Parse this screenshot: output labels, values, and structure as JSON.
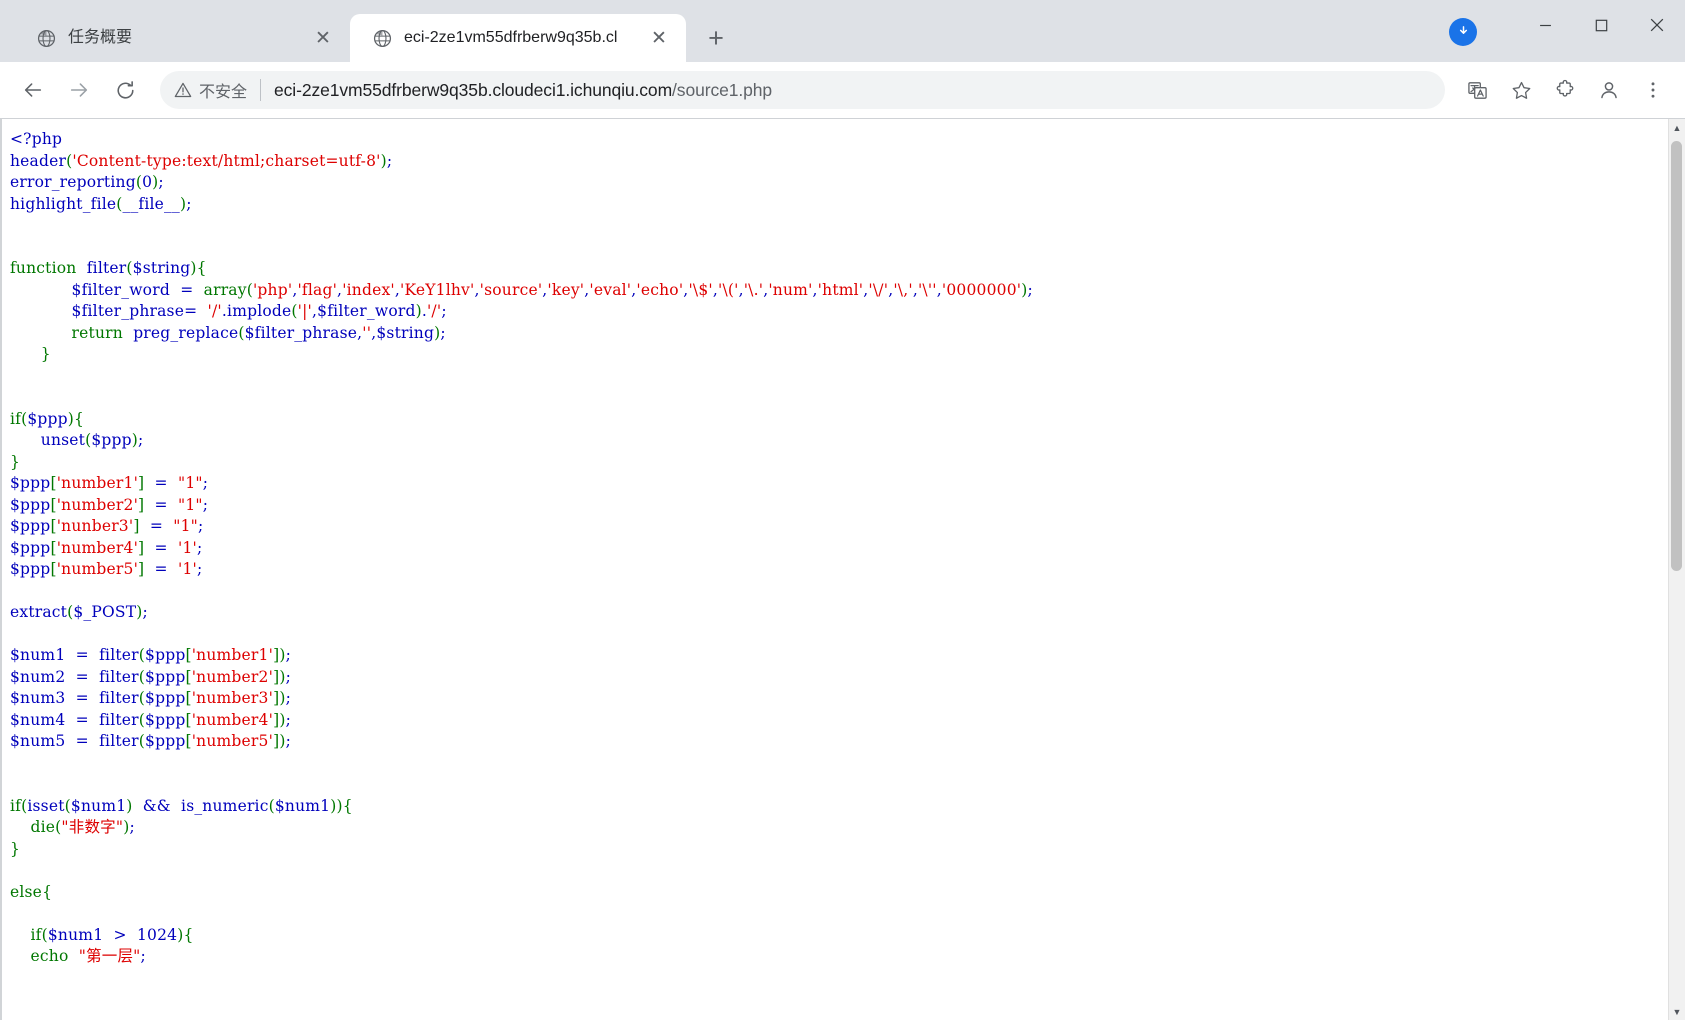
{
  "window": {
    "minimize_label": "Minimize",
    "maximize_label": "Maximize",
    "close_label": "Close"
  },
  "tabs": [
    {
      "title": "任务概要",
      "favicon": "globe-icon",
      "active": false,
      "close_label": "✕"
    },
    {
      "title": "eci-2ze1vm55dfrberw9q35b.cl",
      "favicon": "globe-icon",
      "active": true,
      "close_label": "✕"
    }
  ],
  "newtab_label": "+",
  "toolbar": {
    "back_label": "←",
    "forward_label": "→",
    "reload_label": "⟳",
    "security_label": "不安全",
    "url_display": "eci-2ze1vm55dfrberw9q35b.cloudeci1.ichunqiu.com",
    "url_path": "/source1.php",
    "translate_icon": "translate-icon",
    "bookmark_icon": "star-icon",
    "extensions_icon": "puzzle-icon",
    "profile_icon": "person-icon",
    "menu_icon": "three-dots-icon",
    "download_icon": "download-arrow-icon"
  },
  "colors": {
    "php_default": "#0000BB",
    "php_string": "#DD0000",
    "php_keyword": "#007700",
    "chrome_toolbar": "#ffffff",
    "chrome_tabstrip": "#dee1e6",
    "omnibox_bg": "#f1f3f4",
    "accent_blue": "#1a73e8"
  },
  "page": {
    "language": "php",
    "rendered_by": "highlight_file",
    "code_lines": [
      [
        {
          "t": "<?php",
          "c": "kw"
        }
      ],
      [
        {
          "t": "header",
          "c": "kw"
        },
        {
          "t": "(",
          "c": "pun"
        },
        {
          "t": "'Content-type:text/html;charset=utf-8'",
          "c": "str"
        },
        {
          "t": ")",
          "c": "pun"
        },
        {
          "t": ";",
          "c": "kw"
        }
      ],
      [
        {
          "t": "error_reporting",
          "c": "kw"
        },
        {
          "t": "(",
          "c": "pun"
        },
        {
          "t": "0",
          "c": "kw"
        },
        {
          "t": ")",
          "c": "pun"
        },
        {
          "t": ";",
          "c": "kw"
        }
      ],
      [
        {
          "t": "highlight_file",
          "c": "kw"
        },
        {
          "t": "(",
          "c": "pun"
        },
        {
          "t": "__file__",
          "c": "kw"
        },
        {
          "t": ")",
          "c": "pun"
        },
        {
          "t": ";",
          "c": "kw"
        }
      ],
      [
        {
          "t": "",
          "c": "kw"
        }
      ],
      [
        {
          "t": "",
          "c": "kw"
        }
      ],
      [
        {
          "t": "function",
          "c": "fn"
        },
        {
          "t": "  ",
          "c": "kw"
        },
        {
          "t": "filter",
          "c": "kw"
        },
        {
          "t": "(",
          "c": "pun"
        },
        {
          "t": "$string",
          "c": "kw"
        },
        {
          "t": ")",
          "c": "pun"
        },
        {
          "t": "{",
          "c": "pun"
        }
      ],
      [
        {
          "t": "            ",
          "c": "kw"
        },
        {
          "t": "$filter_word",
          "c": "kw"
        },
        {
          "t": "  =  ",
          "c": "kw"
        },
        {
          "t": "array",
          "c": "fn"
        },
        {
          "t": "(",
          "c": "pun"
        },
        {
          "t": "'php'",
          "c": "str"
        },
        {
          "t": ",",
          "c": "kw"
        },
        {
          "t": "'flag'",
          "c": "str"
        },
        {
          "t": ",",
          "c": "kw"
        },
        {
          "t": "'index'",
          "c": "str"
        },
        {
          "t": ",",
          "c": "kw"
        },
        {
          "t": "'KeY1lhv'",
          "c": "str"
        },
        {
          "t": ",",
          "c": "kw"
        },
        {
          "t": "'source'",
          "c": "str"
        },
        {
          "t": ",",
          "c": "kw"
        },
        {
          "t": "'key'",
          "c": "str"
        },
        {
          "t": ",",
          "c": "kw"
        },
        {
          "t": "'eval'",
          "c": "str"
        },
        {
          "t": ",",
          "c": "kw"
        },
        {
          "t": "'echo'",
          "c": "str"
        },
        {
          "t": ",",
          "c": "kw"
        },
        {
          "t": "'\\$'",
          "c": "str"
        },
        {
          "t": ",",
          "c": "kw"
        },
        {
          "t": "'\\('",
          "c": "str"
        },
        {
          "t": ",",
          "c": "kw"
        },
        {
          "t": "'\\.'",
          "c": "str"
        },
        {
          "t": ",",
          "c": "kw"
        },
        {
          "t": "'num'",
          "c": "str"
        },
        {
          "t": ",",
          "c": "kw"
        },
        {
          "t": "'html'",
          "c": "str"
        },
        {
          "t": ",",
          "c": "kw"
        },
        {
          "t": "'\\/'",
          "c": "str"
        },
        {
          "t": ",",
          "c": "kw"
        },
        {
          "t": "'\\,'",
          "c": "str"
        },
        {
          "t": ",",
          "c": "kw"
        },
        {
          "t": "'\\''",
          "c": "str"
        },
        {
          "t": ",",
          "c": "kw"
        },
        {
          "t": "'0000000'",
          "c": "str"
        },
        {
          "t": ")",
          "c": "pun"
        },
        {
          "t": ";",
          "c": "kw"
        }
      ],
      [
        {
          "t": "            ",
          "c": "kw"
        },
        {
          "t": "$filter_phrase",
          "c": "kw"
        },
        {
          "t": "=  ",
          "c": "kw"
        },
        {
          "t": "'/'",
          "c": "str"
        },
        {
          "t": ".",
          "c": "kw"
        },
        {
          "t": "implode",
          "c": "kw"
        },
        {
          "t": "(",
          "c": "pun"
        },
        {
          "t": "'|'",
          "c": "str"
        },
        {
          "t": ",",
          "c": "kw"
        },
        {
          "t": "$filter_word",
          "c": "kw"
        },
        {
          "t": ")",
          "c": "pun"
        },
        {
          "t": ".",
          "c": "kw"
        },
        {
          "t": "'/'",
          "c": "str"
        },
        {
          "t": ";",
          "c": "kw"
        }
      ],
      [
        {
          "t": "            ",
          "c": "kw"
        },
        {
          "t": "return",
          "c": "fn"
        },
        {
          "t": "  ",
          "c": "kw"
        },
        {
          "t": "preg_replace",
          "c": "kw"
        },
        {
          "t": "(",
          "c": "pun"
        },
        {
          "t": "$filter_phrase",
          "c": "kw"
        },
        {
          "t": ",",
          "c": "kw"
        },
        {
          "t": "''",
          "c": "str"
        },
        {
          "t": ",",
          "c": "kw"
        },
        {
          "t": "$string",
          "c": "kw"
        },
        {
          "t": ")",
          "c": "pun"
        },
        {
          "t": ";",
          "c": "kw"
        }
      ],
      [
        {
          "t": "      ",
          "c": "kw"
        },
        {
          "t": "}",
          "c": "pun"
        }
      ],
      [
        {
          "t": "",
          "c": "kw"
        }
      ],
      [
        {
          "t": "",
          "c": "kw"
        }
      ],
      [
        {
          "t": "if",
          "c": "fn"
        },
        {
          "t": "(",
          "c": "pun"
        },
        {
          "t": "$ppp",
          "c": "kw"
        },
        {
          "t": ")",
          "c": "pun"
        },
        {
          "t": "{",
          "c": "pun"
        }
      ],
      [
        {
          "t": "      ",
          "c": "kw"
        },
        {
          "t": "unset",
          "c": "kw"
        },
        {
          "t": "(",
          "c": "pun"
        },
        {
          "t": "$ppp",
          "c": "kw"
        },
        {
          "t": ")",
          "c": "pun"
        },
        {
          "t": ";",
          "c": "kw"
        }
      ],
      [
        {
          "t": "}",
          "c": "pun"
        }
      ],
      [
        {
          "t": "$ppp",
          "c": "kw"
        },
        {
          "t": "[",
          "c": "pun"
        },
        {
          "t": "'number1'",
          "c": "str"
        },
        {
          "t": "]",
          "c": "pun"
        },
        {
          "t": "  =  ",
          "c": "kw"
        },
        {
          "t": "\"1\"",
          "c": "str"
        },
        {
          "t": ";",
          "c": "kw"
        }
      ],
      [
        {
          "t": "$ppp",
          "c": "kw"
        },
        {
          "t": "[",
          "c": "pun"
        },
        {
          "t": "'number2'",
          "c": "str"
        },
        {
          "t": "]",
          "c": "pun"
        },
        {
          "t": "  =  ",
          "c": "kw"
        },
        {
          "t": "\"1\"",
          "c": "str"
        },
        {
          "t": ";",
          "c": "kw"
        }
      ],
      [
        {
          "t": "$ppp",
          "c": "kw"
        },
        {
          "t": "[",
          "c": "pun"
        },
        {
          "t": "'nunber3'",
          "c": "str"
        },
        {
          "t": "]",
          "c": "pun"
        },
        {
          "t": "  =  ",
          "c": "kw"
        },
        {
          "t": "\"1\"",
          "c": "str"
        },
        {
          "t": ";",
          "c": "kw"
        }
      ],
      [
        {
          "t": "$ppp",
          "c": "kw"
        },
        {
          "t": "[",
          "c": "pun"
        },
        {
          "t": "'number4'",
          "c": "str"
        },
        {
          "t": "]",
          "c": "pun"
        },
        {
          "t": "  =  ",
          "c": "kw"
        },
        {
          "t": "'1'",
          "c": "str"
        },
        {
          "t": ";",
          "c": "kw"
        }
      ],
      [
        {
          "t": "$ppp",
          "c": "kw"
        },
        {
          "t": "[",
          "c": "pun"
        },
        {
          "t": "'number5'",
          "c": "str"
        },
        {
          "t": "]",
          "c": "pun"
        },
        {
          "t": "  =  ",
          "c": "kw"
        },
        {
          "t": "'1'",
          "c": "str"
        },
        {
          "t": ";",
          "c": "kw"
        }
      ],
      [
        {
          "t": "",
          "c": "kw"
        }
      ],
      [
        {
          "t": "extract",
          "c": "kw"
        },
        {
          "t": "(",
          "c": "pun"
        },
        {
          "t": "$_POST",
          "c": "kw"
        },
        {
          "t": ")",
          "c": "pun"
        },
        {
          "t": ";",
          "c": "kw"
        }
      ],
      [
        {
          "t": "",
          "c": "kw"
        }
      ],
      [
        {
          "t": "$num1",
          "c": "kw"
        },
        {
          "t": "  =  ",
          "c": "kw"
        },
        {
          "t": "filter",
          "c": "kw"
        },
        {
          "t": "(",
          "c": "pun"
        },
        {
          "t": "$ppp",
          "c": "kw"
        },
        {
          "t": "[",
          "c": "pun"
        },
        {
          "t": "'number1'",
          "c": "str"
        },
        {
          "t": "]",
          "c": "pun"
        },
        {
          "t": ")",
          "c": "pun"
        },
        {
          "t": ";",
          "c": "kw"
        }
      ],
      [
        {
          "t": "$num2",
          "c": "kw"
        },
        {
          "t": "  =  ",
          "c": "kw"
        },
        {
          "t": "filter",
          "c": "kw"
        },
        {
          "t": "(",
          "c": "pun"
        },
        {
          "t": "$ppp",
          "c": "kw"
        },
        {
          "t": "[",
          "c": "pun"
        },
        {
          "t": "'number2'",
          "c": "str"
        },
        {
          "t": "]",
          "c": "pun"
        },
        {
          "t": ")",
          "c": "pun"
        },
        {
          "t": ";",
          "c": "kw"
        }
      ],
      [
        {
          "t": "$num3",
          "c": "kw"
        },
        {
          "t": "  =  ",
          "c": "kw"
        },
        {
          "t": "filter",
          "c": "kw"
        },
        {
          "t": "(",
          "c": "pun"
        },
        {
          "t": "$ppp",
          "c": "kw"
        },
        {
          "t": "[",
          "c": "pun"
        },
        {
          "t": "'number3'",
          "c": "str"
        },
        {
          "t": "]",
          "c": "pun"
        },
        {
          "t": ")",
          "c": "pun"
        },
        {
          "t": ";",
          "c": "kw"
        }
      ],
      [
        {
          "t": "$num4",
          "c": "kw"
        },
        {
          "t": "  =  ",
          "c": "kw"
        },
        {
          "t": "filter",
          "c": "kw"
        },
        {
          "t": "(",
          "c": "pun"
        },
        {
          "t": "$ppp",
          "c": "kw"
        },
        {
          "t": "[",
          "c": "pun"
        },
        {
          "t": "'number4'",
          "c": "str"
        },
        {
          "t": "]",
          "c": "pun"
        },
        {
          "t": ")",
          "c": "pun"
        },
        {
          "t": ";",
          "c": "kw"
        }
      ],
      [
        {
          "t": "$num5",
          "c": "kw"
        },
        {
          "t": "  =  ",
          "c": "kw"
        },
        {
          "t": "filter",
          "c": "kw"
        },
        {
          "t": "(",
          "c": "pun"
        },
        {
          "t": "$ppp",
          "c": "kw"
        },
        {
          "t": "[",
          "c": "pun"
        },
        {
          "t": "'number5'",
          "c": "str"
        },
        {
          "t": "]",
          "c": "pun"
        },
        {
          "t": ")",
          "c": "pun"
        },
        {
          "t": ";",
          "c": "kw"
        }
      ],
      [
        {
          "t": "",
          "c": "kw"
        }
      ],
      [
        {
          "t": "",
          "c": "kw"
        }
      ],
      [
        {
          "t": "if",
          "c": "fn"
        },
        {
          "t": "(",
          "c": "pun"
        },
        {
          "t": "isset",
          "c": "kw"
        },
        {
          "t": "(",
          "c": "pun"
        },
        {
          "t": "$num1",
          "c": "kw"
        },
        {
          "t": ")",
          "c": "pun"
        },
        {
          "t": "  &&  ",
          "c": "kw"
        },
        {
          "t": "is_numeric",
          "c": "kw"
        },
        {
          "t": "(",
          "c": "pun"
        },
        {
          "t": "$num1",
          "c": "kw"
        },
        {
          "t": ")",
          "c": "pun"
        },
        {
          "t": ")",
          "c": "pun"
        },
        {
          "t": "{",
          "c": "pun"
        }
      ],
      [
        {
          "t": "    ",
          "c": "kw"
        },
        {
          "t": "die",
          "c": "fn"
        },
        {
          "t": "(",
          "c": "pun"
        },
        {
          "t": "\"非数字\"",
          "c": "str"
        },
        {
          "t": ")",
          "c": "pun"
        },
        {
          "t": ";",
          "c": "kw"
        }
      ],
      [
        {
          "t": "}",
          "c": "pun"
        }
      ],
      [
        {
          "t": "",
          "c": "kw"
        }
      ],
      [
        {
          "t": "else",
          "c": "fn"
        },
        {
          "t": "{",
          "c": "pun"
        }
      ],
      [
        {
          "t": "",
          "c": "kw"
        }
      ],
      [
        {
          "t": "    ",
          "c": "kw"
        },
        {
          "t": "if",
          "c": "fn"
        },
        {
          "t": "(",
          "c": "pun"
        },
        {
          "t": "$num1",
          "c": "kw"
        },
        {
          "t": "  >  ",
          "c": "kw"
        },
        {
          "t": "1024",
          "c": "kw"
        },
        {
          "t": ")",
          "c": "pun"
        },
        {
          "t": "{",
          "c": "pun"
        }
      ],
      [
        {
          "t": "    ",
          "c": "kw"
        },
        {
          "t": "echo",
          "c": "fn"
        },
        {
          "t": "  ",
          "c": "kw"
        },
        {
          "t": "\"第一层\"",
          "c": "str"
        },
        {
          "t": ";",
          "c": "kw"
        }
      ]
    ]
  }
}
